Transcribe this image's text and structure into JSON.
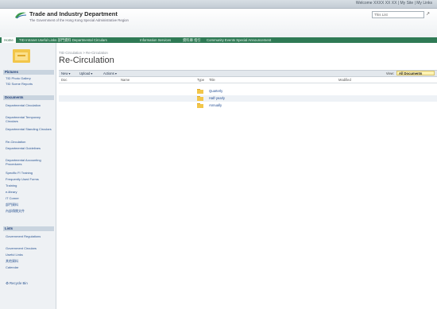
{
  "topbar": {
    "welcome_text": "Welcome XXXX XX XX  |  My Site  |  My Links"
  },
  "brand": {
    "title": "Trade and Industry Department",
    "subtitle": "The Government of the Hong Kong Special Administrative Region"
  },
  "search": {
    "scope": "This List",
    "go_glyph": "↗"
  },
  "nav": {
    "home": "Home",
    "tabs": [
      "TID Intranet   Useful Links   部門資料   Departmental Circulars",
      "Information Services",
      "資料庫  指引",
      "Community Events  Special Announcement"
    ]
  },
  "sidebar": {
    "sections": [
      {
        "title": "Pictures",
        "items": [
          "TID Photo Gallery",
          "TID Scene Reports"
        ]
      },
      {
        "title": "Documents",
        "items": [
          "Departmental Circulation",
          "Departmental Temporary Circulars",
          "Departmental Standing Circulars",
          "Re-Circulation",
          "Departmental Guidelines",
          "Departmental Accounting Procedures",
          "Specific FI Training",
          "Frequently Used Forms",
          "Training",
          "e-library",
          "IT Corner",
          "部門資料",
          "內部傳閱文件"
        ]
      },
      {
        "title": "Lists",
        "items": [
          "Government Regulations",
          "Government Circulars",
          "Useful Links",
          "其他資料",
          "Calendar"
        ]
      }
    ],
    "recycle_bin": "Recycle Bin"
  },
  "page": {
    "breadcrumb": "TID Circulation > Re-Circulation",
    "title": "Re-Circulation"
  },
  "toolbar": {
    "new_label": "New ▾",
    "upload_label": "Upload ▾",
    "actions_label": "Actions ▾",
    "view_label": "View:",
    "view_value": "All Documents"
  },
  "columns": [
    "Doc",
    "Name",
    "Type",
    "Title",
    "Modified"
  ],
  "rows": [
    {
      "name": "Quarterly"
    },
    {
      "name": "Half-yearly"
    },
    {
      "name": "Annually"
    }
  ],
  "colors": {
    "nav_green": "#2f7a55",
    "accent_blue": "#244e94",
    "view_highlight": "#fff3b3"
  }
}
